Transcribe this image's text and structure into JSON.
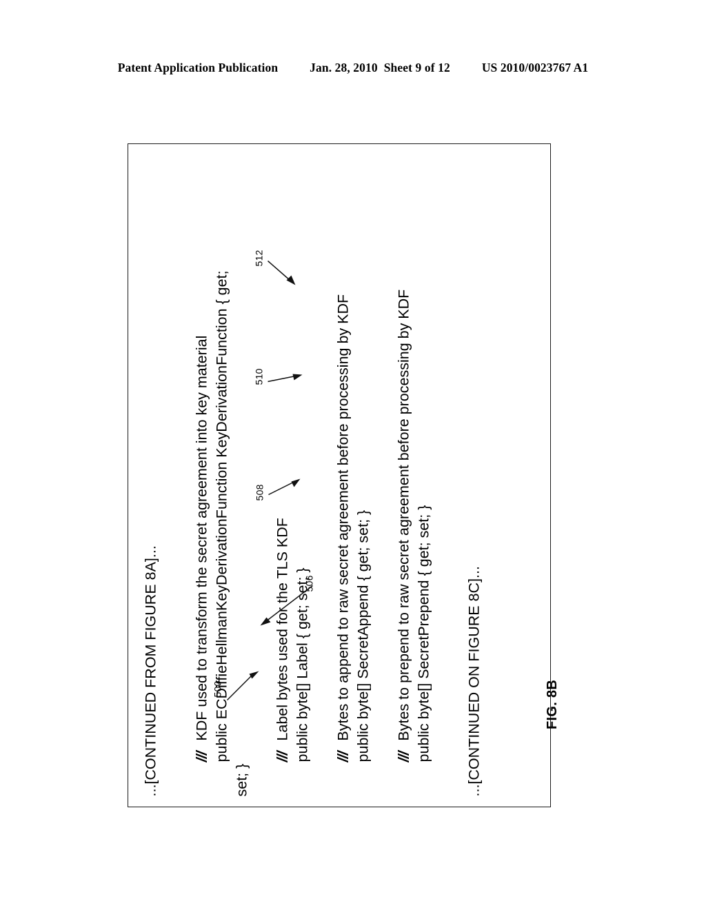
{
  "header": {
    "publication": "Patent Application Publication",
    "date": "Jan. 28, 2010",
    "sheet": "Sheet 9 of 12",
    "patent_number": "US 2010/0023767 A1"
  },
  "figure": {
    "caption": "FIG. 8B",
    "continued_from": "...[CONTINUED FROM FIGURE 8A]...",
    "continued_on": "...[CONTINUED ON FIGURE 8C]...",
    "comment_marker": "///",
    "blocks": [
      {
        "comment": "KDF used to transform the secret agreement into key material",
        "declaration": "public ECDiffieHellmanKeyDerivationFunction KeyDerivationFunction { get;",
        "declaration_wrap": "set; }",
        "ref": "506"
      },
      {
        "comment": "Label bytes used for the TLS KDF",
        "declaration": "public byte[] Label { get; set; }",
        "ref": "508"
      },
      {
        "comment": "Bytes to append to raw secret agreement before processing by KDF",
        "declaration": "public byte[] SecretAppend { get; set; }",
        "ref": "510"
      },
      {
        "comment": "Bytes to prepend to raw secret agreement before processing by KDF",
        "declaration": "public byte[] SecretPrepend { get; set; }",
        "ref": "512"
      }
    ],
    "ref_overall": "500"
  }
}
